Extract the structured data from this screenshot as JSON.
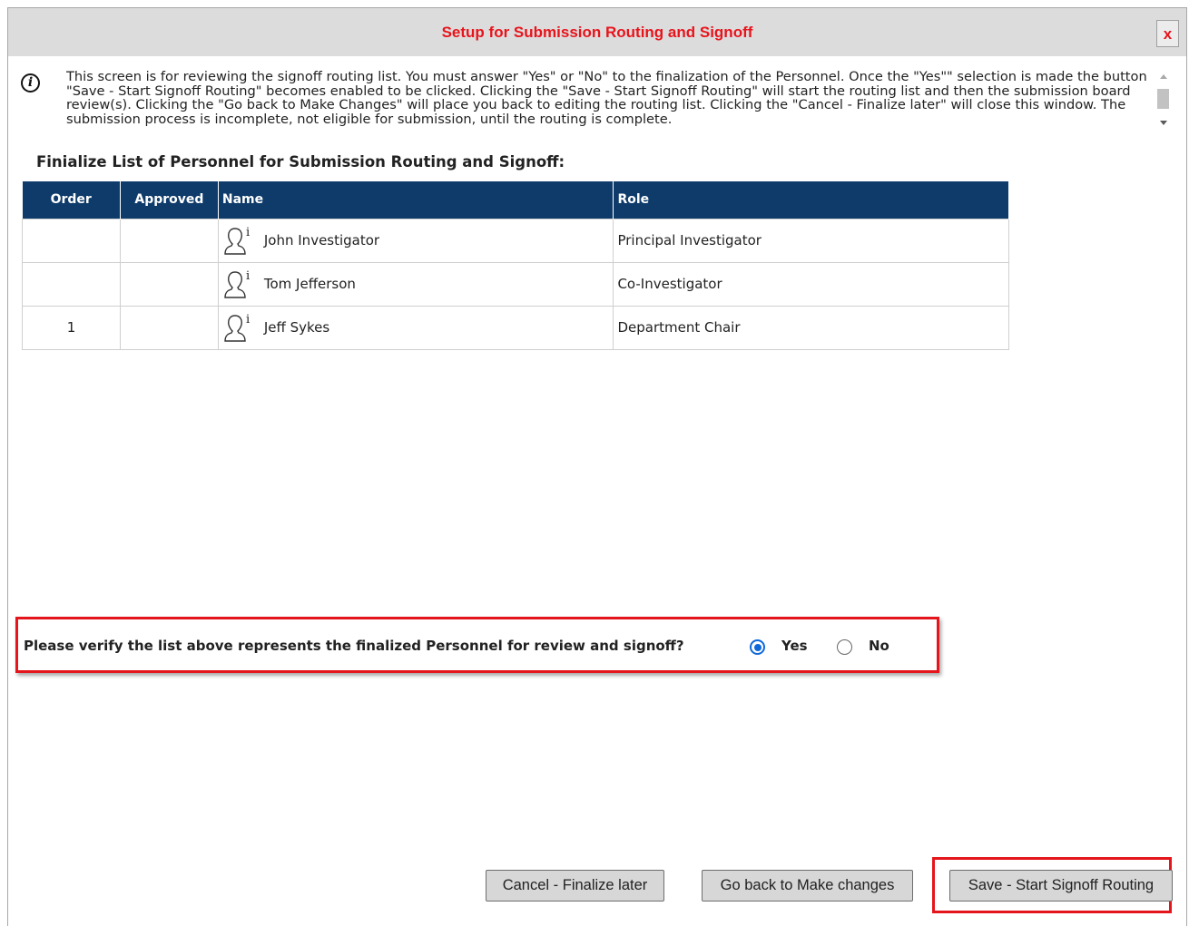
{
  "dialog": {
    "title": "Setup for Submission Routing and Signoff",
    "close_label": "x",
    "info_text": "This screen is for reviewing the signoff routing list. You must answer \"Yes\" or \"No\" to the finalization of the Personnel. Once the \"Yes\"\" selection is made the button \"Save - Start Signoff Routing\" becomes enabled to be clicked. Clicking the \"Save - Start Signoff Routing\" will start the routing list and then the submission board review(s). Clicking the \"Go back to Make Changes\" will place you back to editing the routing list. Clicking the \"Cancel - Finalize later\" will close this window. The submission process is incomplete, not eligible for submission, until the routing is complete."
  },
  "section": {
    "heading": "Finialize List of Personnel for Submission Routing and Signoff:"
  },
  "table": {
    "headers": {
      "order": "Order",
      "approved": "Approved",
      "name": "Name",
      "role": "Role"
    },
    "rows": [
      {
        "order": "",
        "approved": "",
        "name": "John Investigator",
        "role": "Principal Investigator"
      },
      {
        "order": "",
        "approved": "",
        "name": "Tom Jefferson",
        "role": "Co-Investigator"
      },
      {
        "order": "1",
        "approved": "",
        "name": "Jeff Sykes",
        "role": "Department Chair"
      }
    ]
  },
  "verify": {
    "question": "Please verify the list above represents the finalized Personnel for review and signoff?",
    "yes_label": "Yes",
    "no_label": "No",
    "selected": "Yes"
  },
  "buttons": {
    "cancel": "Cancel - Finalize later",
    "go_back": "Go back to Make changes",
    "save": "Save - Start Signoff Routing"
  },
  "icons": {
    "info": "info-icon",
    "person": "person-info-icon"
  },
  "colors": {
    "title": "#e8141c",
    "table_header": "#0e3b6a",
    "highlight": "#e4161c",
    "radio": "#0f68d9"
  }
}
